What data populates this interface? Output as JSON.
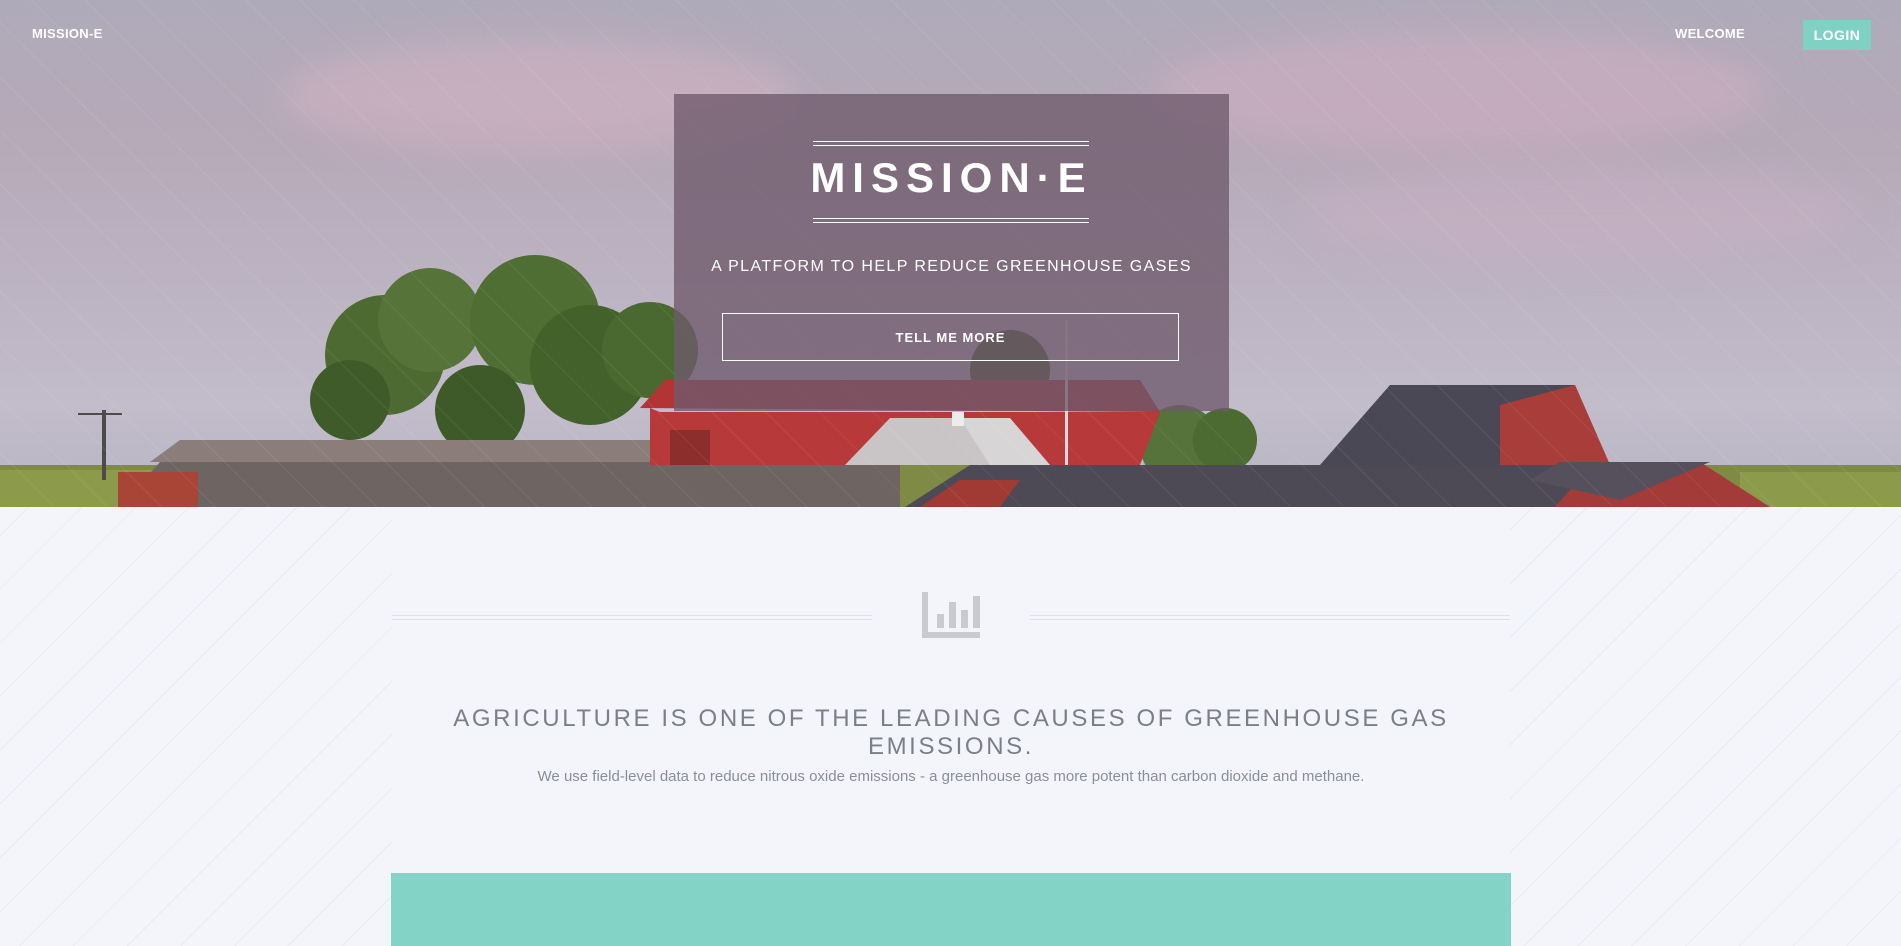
{
  "nav": {
    "brand": "MISSION-E",
    "welcome": "WELCOME",
    "login": "LOGIN"
  },
  "hero": {
    "title": "MISSION·E",
    "tagline": "A PLATFORM TO HELP REDUCE GREENHOUSE GASES",
    "cta": "TELL ME MORE"
  },
  "section": {
    "icon": "bar-chart-icon",
    "headline": "AGRICULTURE IS ONE OF THE LEADING CAUSES OF GREENHOUSE GAS EMISSIONS.",
    "body": "We use field-level data to reduce nitrous oxide emissions - a greenhouse gas more potent than carbon dioxide and methane."
  },
  "colors": {
    "accent": "#84d3c7",
    "panel": "#6e5a6c",
    "text_muted": "#7b7f88"
  }
}
